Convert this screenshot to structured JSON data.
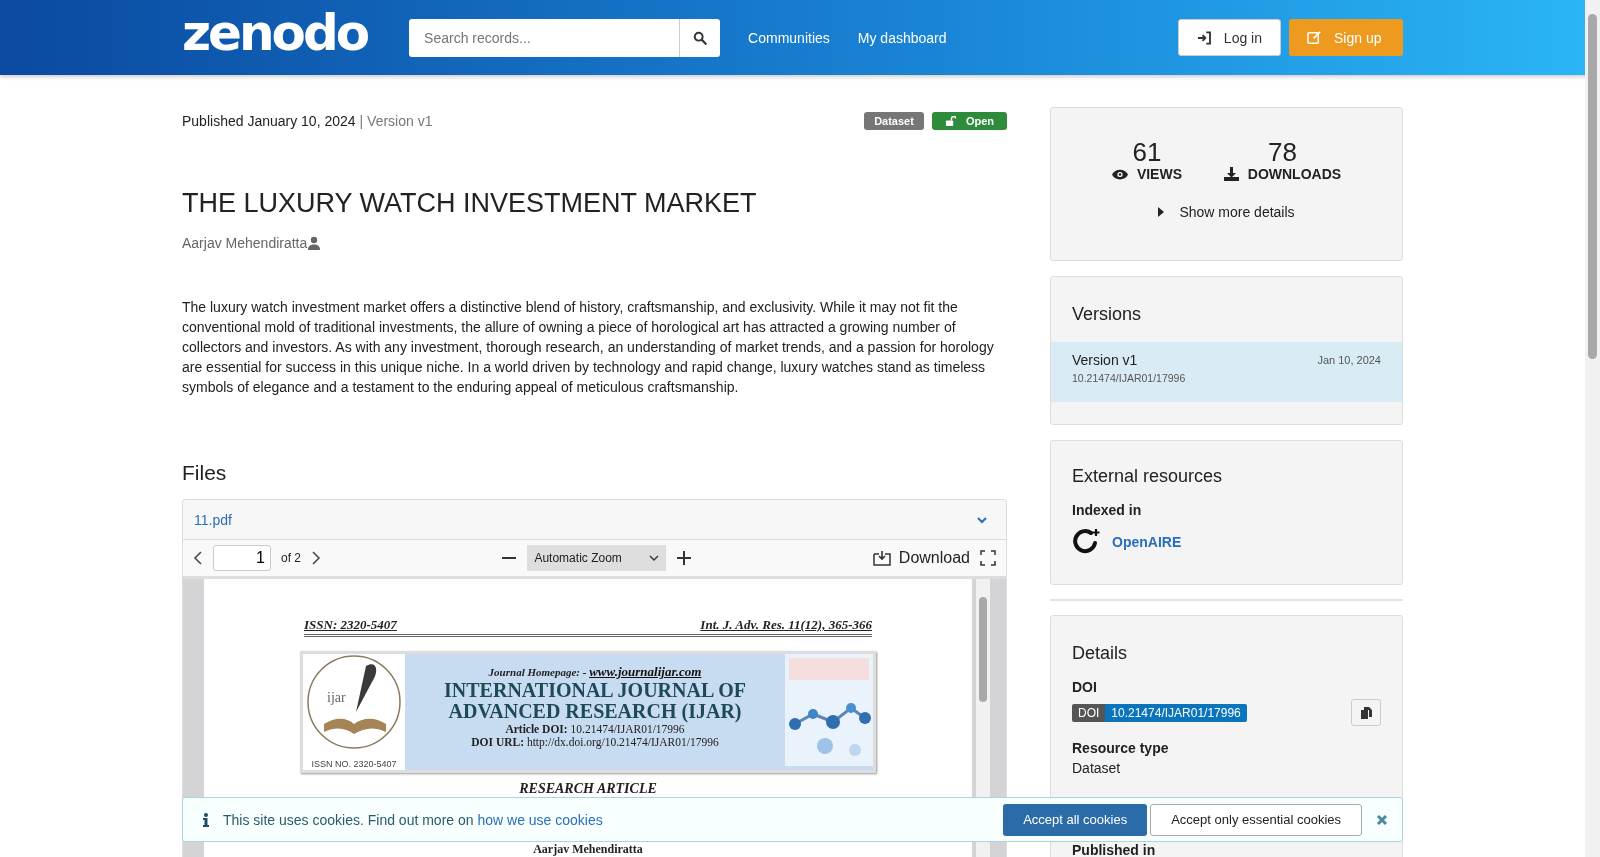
{
  "header": {
    "logo": "zenodo",
    "search": {
      "placeholder": "Search records..."
    },
    "nav": [
      "Communities",
      "My dashboard"
    ],
    "buttons": [
      {
        "label": "Log in",
        "kind": "login"
      },
      {
        "label": "Sign up",
        "kind": "signup"
      }
    ]
  },
  "record": {
    "published": "Published January 10, 2024",
    "version": "| Version v1",
    "badges": [
      {
        "label": "Dataset",
        "kind": "type"
      },
      {
        "label": "Open",
        "kind": "access"
      }
    ],
    "title": "THE LUXURY WATCH INVESTMENT MARKET",
    "creators": [
      "Aarjav Mehendiratta"
    ],
    "description": "The luxury watch investment market offers a distinctive blend of history, craftsmanship, and exclusivity. While it may not fit the conventional mold of traditional investments, the allure of owning a piece of horological art has attracted a growing number of collectors and investors. As with any investment, thorough research, an understanding of market trends, and a passion for horology are essential for success in this unique niche. In a world driven by technology and rapid change, luxury watches stand as timeless symbols of elegance and a testament to the enduring appeal of meticulous craftsmanship."
  },
  "files": {
    "heading": "Files",
    "file_name": "11.pdf",
    "expanded": true,
    "viewer": {
      "page": "1",
      "page_count": "of 2",
      "zoom": "Automatic Zoom",
      "download": "Download"
    },
    "document": {
      "header_left": "ISSN: 2320-5407",
      "header_right": "Int. J. Adv. Res. 11(12), 365-366",
      "logo_text": "ijar",
      "logo_issn": "ISSN NO. 2320-5407",
      "homepage_label": "Journal Homepage: -",
      "homepage_url": "www.journalijar.com",
      "journal_name": [
        "INTERNATIONAL JOURNAL OF",
        "ADVANCED RESEARCH (IJAR)"
      ],
      "article_doi_label": "Article DOI:",
      "article_doi": "10.21474/IJAR01/17996",
      "doi_url_label": "DOI URL:",
      "doi_url": "http://dx.doi.org/10.21474/IJAR01/17996",
      "section": "RESEARCH ARTICLE",
      "author": "Aarjav Mehendiratta"
    }
  },
  "sidebar": {
    "stats": [
      {
        "value": "61",
        "label": "VIEWS",
        "kind": "views"
      },
      {
        "value": "78",
        "label": "DOWNLOADS",
        "kind": "downloads"
      }
    ],
    "show_more": "Show more details",
    "versions": {
      "heading": "Versions",
      "items": [
        {
          "label": "Version v1",
          "date": "Jan 10, 2024",
          "doi": "10.21474/IJAR01/17996",
          "selected": true
        }
      ]
    },
    "external": {
      "heading": "External resources",
      "subheading": "Indexed in",
      "links": [
        "OpenAIRE"
      ]
    },
    "details": {
      "heading": "Details",
      "doi_label": "DOI",
      "doi_prefix": "DOI",
      "doi": "10.21474/IJAR01/17996",
      "resource_type_label": "Resource type",
      "resource_type": "Dataset",
      "published_in_label": "Published in"
    }
  },
  "cookie_banner": {
    "text": "This site uses cookies. Find out more on",
    "link": "how we use cookies",
    "buttons": [
      {
        "label": "Accept all cookies",
        "kind": "primary"
      },
      {
        "label": "Accept only essential cookies",
        "kind": "secondary"
      }
    ]
  }
}
